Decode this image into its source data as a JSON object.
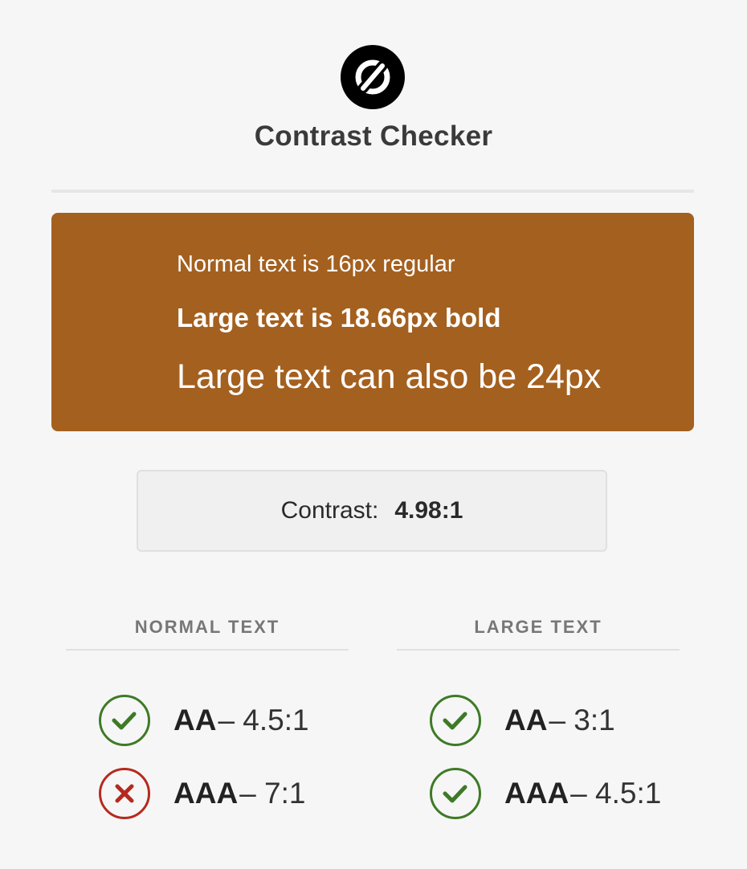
{
  "app": {
    "title": "Contrast Checker",
    "logo_icon": "slashed-circle-logo"
  },
  "preview": {
    "background_color": "#a4601f",
    "text_color": "#ffffff",
    "normal_text": "Normal text is 16px regular",
    "bold_text": "Large text is 18.66px bold",
    "large_text": "Large text can also be 24px"
  },
  "contrast": {
    "label": "Contrast:",
    "value": "4.98:1"
  },
  "results": {
    "normal": {
      "header": "NORMAL TEXT",
      "aa": {
        "level": "AA",
        "ratio": "– 4.5:1",
        "status": "pass",
        "icon": "check-circle-icon"
      },
      "aaa": {
        "level": "AAA",
        "ratio": "– 7:1",
        "status": "fail",
        "icon": "x-circle-icon"
      }
    },
    "large": {
      "header": "LARGE TEXT",
      "aa": {
        "level": "AA",
        "ratio": "– 3:1",
        "status": "pass",
        "icon": "check-circle-icon"
      },
      "aaa": {
        "level": "AAA",
        "ratio": "– 4.5:1",
        "status": "pass",
        "icon": "check-circle-icon"
      }
    }
  },
  "colors": {
    "pass": "#3e7a26",
    "fail": "#b52a1e"
  }
}
